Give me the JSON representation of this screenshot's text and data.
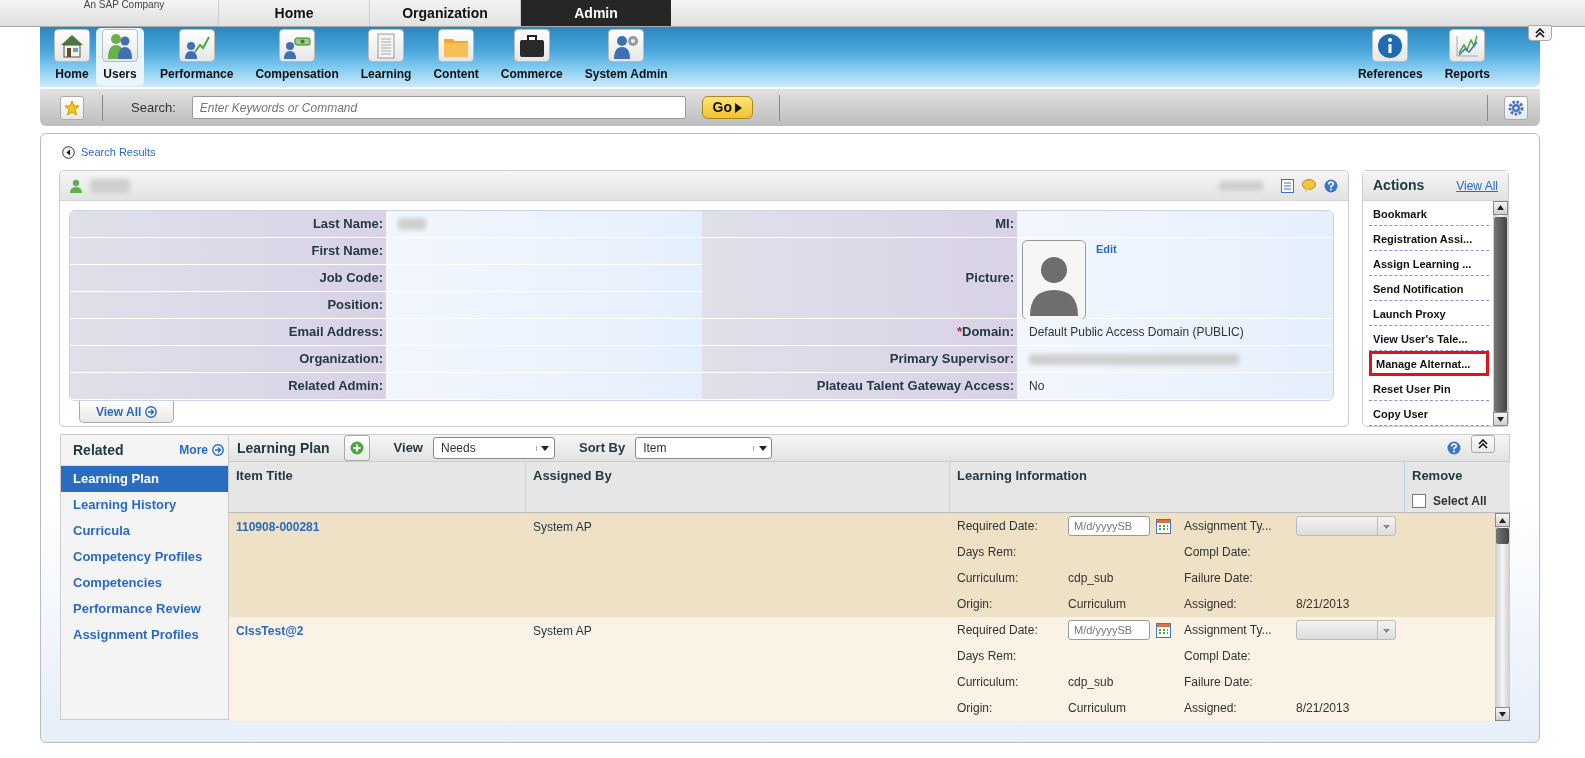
{
  "brand": {
    "tagline": "An SAP Company"
  },
  "top_tabs": [
    {
      "label": "Home",
      "selected": false
    },
    {
      "label": "Organization",
      "selected": false
    },
    {
      "label": "Admin",
      "selected": true
    }
  ],
  "toolbar": {
    "items": [
      {
        "label": "Home",
        "selected": false
      },
      {
        "label": "Users",
        "selected": true
      },
      {
        "label": "Performance",
        "selected": false
      },
      {
        "label": "Compensation",
        "selected": false
      },
      {
        "label": "Learning",
        "selected": false
      },
      {
        "label": "Content",
        "selected": false
      },
      {
        "label": "Commerce",
        "selected": false
      },
      {
        "label": "System Admin",
        "selected": false
      }
    ],
    "right_items": [
      {
        "label": "References",
        "selected": false
      },
      {
        "label": "Reports",
        "selected": false
      }
    ]
  },
  "search": {
    "label": "Search:",
    "placeholder": "Enter Keywords or Command",
    "button": "Go"
  },
  "breadcrumb": "Search Results",
  "profile": {
    "name_redacted": true,
    "status_redacted": true,
    "fields_left": [
      {
        "label": "Last Name:",
        "redacted": true
      },
      {
        "label": "First Name:"
      },
      {
        "label": "Job Code:"
      },
      {
        "label": "Position:"
      },
      {
        "label": "Email Address:"
      },
      {
        "label": "Organization:"
      },
      {
        "label": "Related Admin:"
      }
    ],
    "fields_right": [
      {
        "kind": "text",
        "label": "MI:"
      },
      {
        "kind": "picture",
        "label": "Picture:",
        "link": "Edit"
      },
      {
        "kind": "text",
        "required_mark": "*",
        "label": "Domain:",
        "value": "Default Public Access Domain (PUBLIC)"
      },
      {
        "kind": "text",
        "label": "Primary Supervisor:",
        "redacted": true
      },
      {
        "kind": "text",
        "label": "Plateau Talent Gateway Access:",
        "value": "No"
      }
    ],
    "view_all": "View All"
  },
  "actions": {
    "title": "Actions",
    "view_all": "View All",
    "items": [
      {
        "label": "Bookmark",
        "highlighted": false
      },
      {
        "label": "Registration Assi...",
        "highlighted": false
      },
      {
        "label": "Assign Learning ...",
        "highlighted": false
      },
      {
        "label": "Send Notification",
        "highlighted": false
      },
      {
        "label": "Launch Proxy",
        "highlighted": false
      },
      {
        "label": "View User's Tale...",
        "highlighted": false
      },
      {
        "label": "Manage Alternat...",
        "highlighted": true
      },
      {
        "label": "Reset User Pin",
        "highlighted": false
      },
      {
        "label": "Copy User",
        "highlighted": false
      }
    ]
  },
  "related": {
    "title": "Related",
    "more": "More",
    "items": [
      {
        "label": "Learning Plan",
        "selected": true
      },
      {
        "label": "Learning History",
        "selected": false
      },
      {
        "label": "Curricula",
        "selected": false
      },
      {
        "label": "Competency Profiles",
        "selected": false
      },
      {
        "label": "Competencies",
        "selected": false
      },
      {
        "label": "Performance Review",
        "selected": false
      },
      {
        "label": "Assignment Profiles",
        "selected": false
      }
    ]
  },
  "learning_plan": {
    "title": "Learning Plan",
    "view_label": "View",
    "view_value": "Needs",
    "sort_label": "Sort By",
    "sort_value": "Item",
    "columns": [
      "Item Title",
      "Assigned By",
      "Learning Information",
      "Remove"
    ],
    "select_all": {
      "label": "Select All",
      "checked": false
    },
    "rows": [
      {
        "title": "110908-000281",
        "assigned_by": "System AP",
        "selected": true,
        "info": [
          {
            "kind": "date",
            "label": "Required Date:",
            "placeholder": "M/d/yyyySB"
          },
          {
            "kind": "select",
            "label": "Assignment Ty..."
          },
          {
            "kind": "text",
            "label": "Days Rem:"
          },
          {
            "kind": "text",
            "label": "Compl Date:"
          },
          {
            "kind": "text",
            "label": "Curriculum:",
            "value": "cdp_sub"
          },
          {
            "kind": "text",
            "label": "Failure Date:"
          },
          {
            "kind": "text",
            "label": "Origin:",
            "value": "Curriculum"
          },
          {
            "kind": "text",
            "label": "Assigned:",
            "value": "8/21/2013"
          }
        ]
      },
      {
        "title": "ClssTest@2",
        "assigned_by": "System AP",
        "selected": false,
        "info": [
          {
            "kind": "date",
            "label": "Required Date:",
            "placeholder": "M/d/yyyySB"
          },
          {
            "kind": "select",
            "label": "Assignment Ty..."
          },
          {
            "kind": "text",
            "label": "Days Rem:"
          },
          {
            "kind": "text",
            "label": "Compl Date:"
          },
          {
            "kind": "text",
            "label": "Curriculum:",
            "value": "cdp_sub"
          },
          {
            "kind": "text",
            "label": "Failure Date:"
          },
          {
            "kind": "text",
            "label": "Origin:",
            "value": "Curriculum"
          },
          {
            "kind": "text",
            "label": "Assigned:",
            "value": "8/21/2013"
          }
        ]
      }
    ]
  }
}
